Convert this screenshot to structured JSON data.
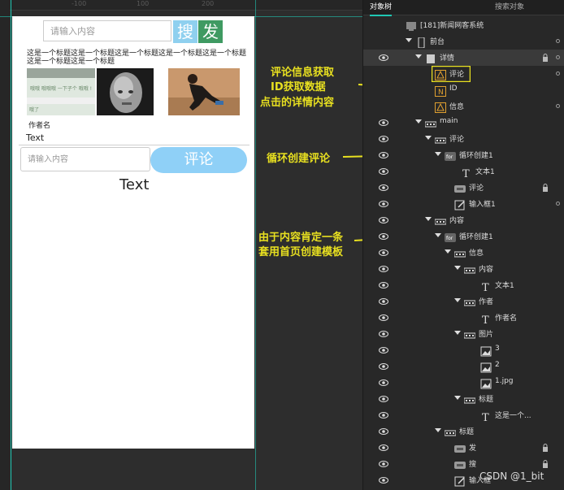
{
  "canvas": {
    "ruler_ticks": [
      "-100",
      "100",
      "200"
    ],
    "search_placeholder": "请输入内容",
    "search_button": "搜",
    "publish_button": "发",
    "title_text": "这是一个标题这是一个标题这是一个标题这是一个标题这是一个标题这是一个标题这是一个标题",
    "author_name": "作者名",
    "text1": "Text",
    "comment_placeholder": "请输入内容",
    "comment_button": "评论",
    "text2": "Text",
    "img1_top_text": "哦哦 哦哦哦 一下子个 哦哦 !",
    "img1_mid_text": "哦哦 哦哦",
    "img1_bot_text": "哦了"
  },
  "annotations": [
    "评论信息获取",
    "ID获取数据",
    "点击的详情内容",
    "循环创建评论",
    "由于内容肯定一条",
    "套用首页创建模板"
  ],
  "panel": {
    "tabs": [
      "对象树",
      "搜索对象"
    ],
    "rows": [
      {
        "label": "[181]新闻网客系统",
        "icon": "app-icon"
      },
      {
        "label": "前台",
        "icon": "phone-icon"
      },
      {
        "label": "详情",
        "icon": "page-icon"
      },
      {
        "label": "评论",
        "icon": "data-icon"
      },
      {
        "label": "ID",
        "icon": "number-icon"
      },
      {
        "label": "信息",
        "icon": "data-icon"
      },
      {
        "label": "main",
        "icon": "container-icon"
      },
      {
        "label": "评论",
        "icon": "container-icon"
      },
      {
        "label": "循环创建1",
        "icon": "for-icon"
      },
      {
        "label": "文本1",
        "icon": "text-icon"
      },
      {
        "label": "评论",
        "icon": "button-icon"
      },
      {
        "label": "输入框1",
        "icon": "input-icon"
      },
      {
        "label": "内容",
        "icon": "container-icon"
      },
      {
        "label": "循环创建1",
        "icon": "for-icon"
      },
      {
        "label": "信息",
        "icon": "container-icon"
      },
      {
        "label": "内容",
        "icon": "container-icon"
      },
      {
        "label": "文本1",
        "icon": "text-icon"
      },
      {
        "label": "作者",
        "icon": "container-icon"
      },
      {
        "label": "作者名",
        "icon": "text-icon"
      },
      {
        "label": "图片",
        "icon": "container-icon"
      },
      {
        "label": "3",
        "icon": "image-icon"
      },
      {
        "label": "2",
        "icon": "image-icon"
      },
      {
        "label": "1.jpg",
        "icon": "image-icon"
      },
      {
        "label": "标题",
        "icon": "container-icon"
      },
      {
        "label": "这是一个...",
        "icon": "text-icon"
      },
      {
        "label": "标题",
        "icon": "container-icon"
      },
      {
        "label": "发",
        "icon": "button-icon"
      },
      {
        "label": "搜",
        "icon": "button-icon"
      },
      {
        "label": "输入框",
        "icon": "input-icon"
      }
    ]
  },
  "watermark": "CSDN @1_bit",
  "colors": {
    "accent": "#1fc7b3",
    "annotation": "#e8e020",
    "search_button": "#8fd0ef",
    "publish_button": "#3f9a62",
    "comment_button": "#8fd0f7"
  }
}
